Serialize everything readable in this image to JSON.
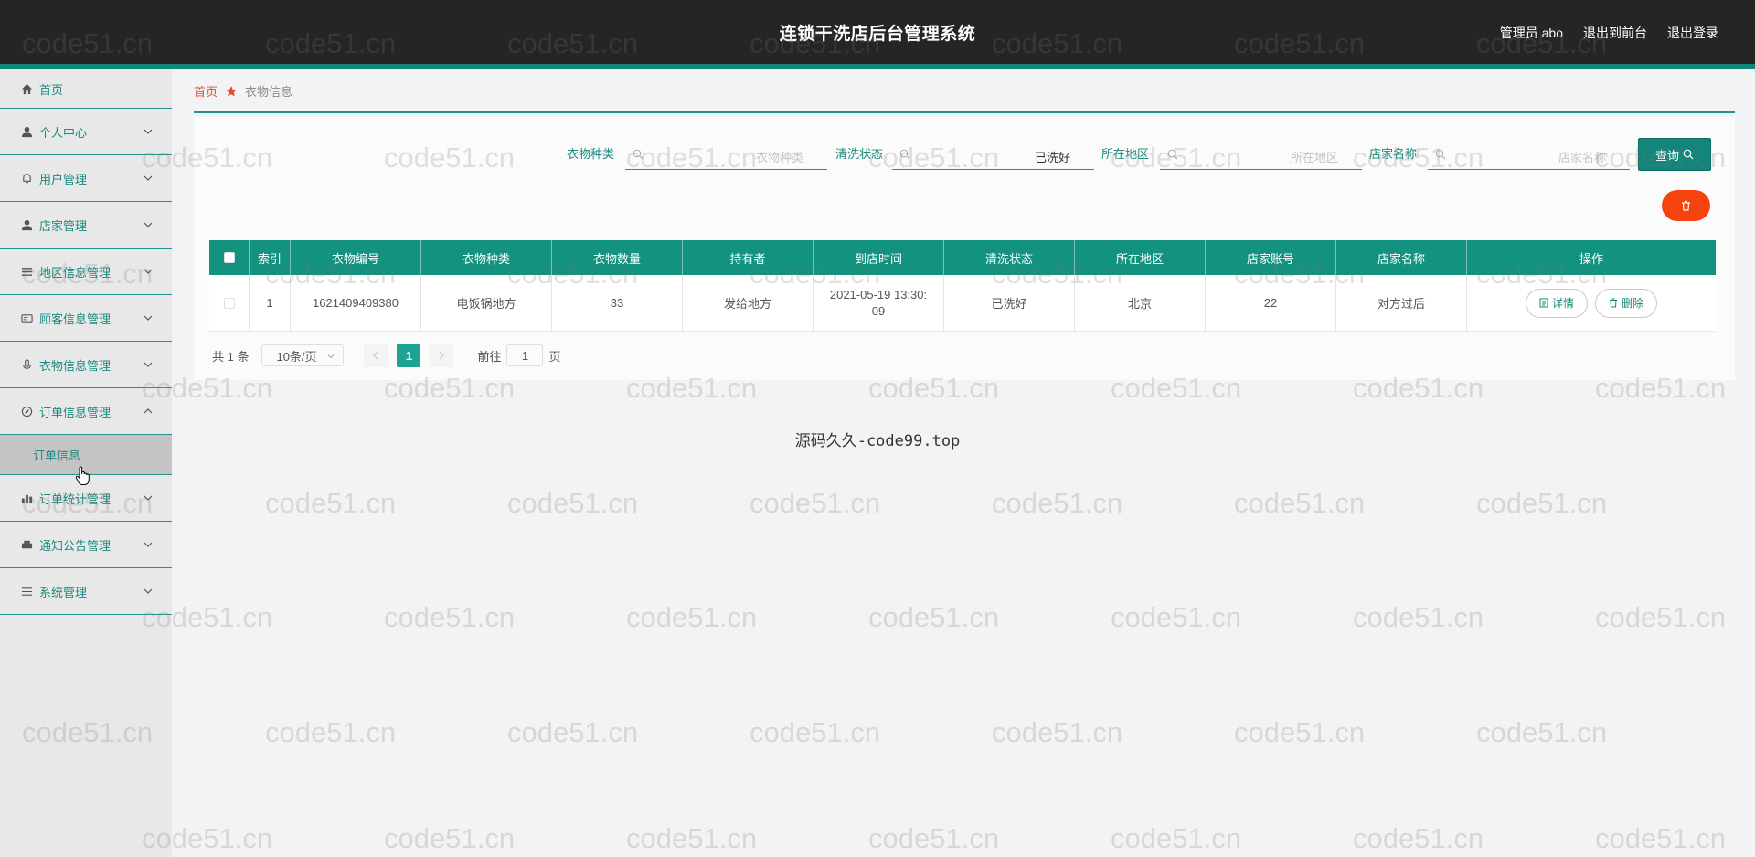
{
  "header": {
    "title": "连锁干洗店后台管理系统",
    "user": "管理员 abo",
    "to_front": "退出到前台",
    "logout": "退出登录"
  },
  "sidebar": {
    "items": [
      {
        "label": "首页",
        "icon": "home-icon"
      },
      {
        "label": "个人中心",
        "icon": "person-icon"
      },
      {
        "label": "用户管理",
        "icon": "bell-icon"
      },
      {
        "label": "店家管理",
        "icon": "person-icon"
      },
      {
        "label": "地区信息管理",
        "icon": "list-icon"
      },
      {
        "label": "顾客信息管理",
        "icon": "card-icon"
      },
      {
        "label": "衣物信息管理",
        "icon": "mic-icon"
      },
      {
        "label": "订单信息管理",
        "icon": "compass-icon"
      },
      {
        "label": "订单统计管理",
        "icon": "bar-chart-icon"
      },
      {
        "label": "通知公告管理",
        "icon": "printer-icon"
      },
      {
        "label": "系统管理",
        "icon": "menu-icon"
      }
    ],
    "sub_item": "订单信息"
  },
  "breadcrumb": {
    "home": "首页",
    "current": "衣物信息"
  },
  "search": {
    "fields": [
      {
        "label": "衣物种类",
        "placeholder": "衣物种类",
        "value": ""
      },
      {
        "label": "清洗状态",
        "placeholder": "",
        "value": "已洗好"
      },
      {
        "label": "所在地区",
        "placeholder": "所在地区",
        "value": ""
      },
      {
        "label": "店家名称",
        "placeholder": "店家名称",
        "value": ""
      }
    ],
    "query_button": "查询"
  },
  "table": {
    "columns": [
      "索引",
      "衣物编号",
      "衣物种类",
      "衣物数量",
      "持有者",
      "到店时间",
      "清洗状态",
      "所在地区",
      "店家账号",
      "店家名称",
      "操作"
    ],
    "rows": [
      {
        "index": "1",
        "code": "1621409409380",
        "type": "电饭锅地方",
        "count": "33",
        "owner": "发给地方",
        "time_line1": "2021-05-19 13:30:",
        "time_line2": "09",
        "status": "已洗好",
        "region": "北京",
        "shop_account": "22",
        "shop_name": "对方过后"
      }
    ],
    "detail_button": "详情",
    "delete_button": "删除"
  },
  "pagination": {
    "total": "共 1 条",
    "page_size": "10条/页",
    "current_page": "1",
    "goto_prefix": "前往",
    "goto_value": "1",
    "goto_suffix": "页"
  },
  "footer_text": "源码久久-code99.top",
  "watermark": "code51.cn",
  "colors": {
    "accent": "#12867a",
    "header_bg": "#252525",
    "danger": "#f5420e",
    "breadcrumb_home": "#e24c32"
  }
}
